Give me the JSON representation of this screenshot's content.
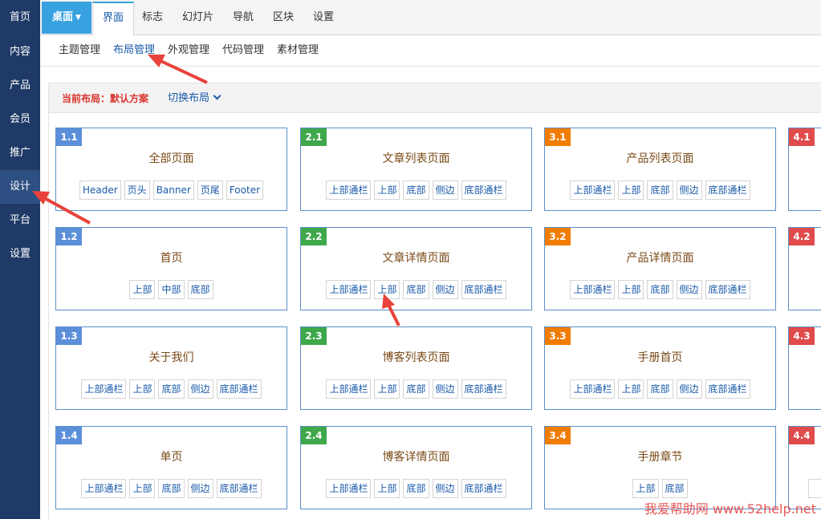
{
  "left_nav": [
    "首页",
    "内容",
    "产品",
    "会员",
    "推广",
    "设计",
    "平台",
    "设置"
  ],
  "top_menu": {
    "desk": "桌面",
    "tabs": [
      "界面",
      "标志",
      "幻灯片",
      "导航",
      "区块",
      "设置"
    ]
  },
  "sub_menu": [
    "主题管理",
    "布局管理",
    "外观管理",
    "代码管理",
    "素材管理"
  ],
  "layout": {
    "current_label": "当前布局：默认方案",
    "switch_label": "切换布局"
  },
  "cards": {
    "c11": {
      "num": "1.1",
      "title": "全部页面",
      "tags": [
        "Header",
        "页头",
        "Banner",
        "页尾",
        "Footer"
      ]
    },
    "c12": {
      "num": "1.2",
      "title": "首页",
      "tags": [
        "上部",
        "中部",
        "底部"
      ]
    },
    "c13": {
      "num": "1.3",
      "title": "关于我们",
      "tags": [
        "上部通栏",
        "上部",
        "底部",
        "侧边",
        "底部通栏"
      ]
    },
    "c14": {
      "num": "1.4",
      "title": "单页",
      "tags": [
        "上部通栏",
        "上部",
        "底部",
        "侧边",
        "底部通栏"
      ]
    },
    "c21": {
      "num": "2.1",
      "title": "文章列表页面",
      "tags": [
        "上部通栏",
        "上部",
        "底部",
        "侧边",
        "底部通栏"
      ]
    },
    "c22": {
      "num": "2.2",
      "title": "文章详情页面",
      "tags": [
        "上部通栏",
        "上部",
        "底部",
        "侧边",
        "底部通栏"
      ]
    },
    "c23": {
      "num": "2.3",
      "title": "博客列表页面",
      "tags": [
        "上部通栏",
        "上部",
        "底部",
        "侧边",
        "底部通栏"
      ]
    },
    "c24": {
      "num": "2.4",
      "title": "博客详情页面",
      "tags": [
        "上部通栏",
        "上部",
        "底部",
        "侧边",
        "底部通栏"
      ]
    },
    "c31": {
      "num": "3.1",
      "title": "产品列表页面",
      "tags": [
        "上部通栏",
        "上部",
        "底部",
        "侧边",
        "底部通栏"
      ]
    },
    "c32": {
      "num": "3.2",
      "title": "产品详情页面",
      "tags": [
        "上部通栏",
        "上部",
        "底部",
        "侧边",
        "底部通栏"
      ]
    },
    "c33": {
      "num": "3.3",
      "title": "手册首页",
      "tags": [
        "上部通栏",
        "上部",
        "底部",
        "侧边",
        "底部通栏"
      ]
    },
    "c34": {
      "num": "3.4",
      "title": "手册章节",
      "tags": [
        "上部",
        "底部"
      ]
    },
    "c41": {
      "num": "4.1"
    },
    "c42": {
      "num": "4.2"
    },
    "c43": {
      "num": "4.3"
    },
    "c44": {
      "num": "4.4"
    }
  },
  "watermark": "我爱帮助网 www.52help.net",
  "colors": {
    "nav_bg": "#1f3a66",
    "accent": "#38a2e0",
    "group1": "#5b8fd9",
    "group2": "#3ea84a",
    "group3": "#f07c00",
    "group4": "#e04b4b",
    "annotation_arrow": "#e8423a"
  }
}
